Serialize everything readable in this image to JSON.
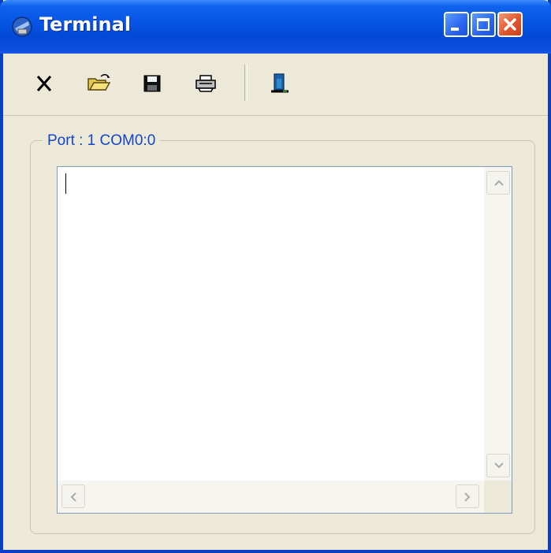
{
  "window": {
    "title": "Terminal",
    "icon": "terminal-app-icon"
  },
  "titlebar_buttons": {
    "minimize": "minimize-icon",
    "maximize": "maximize-icon",
    "close": "close-icon"
  },
  "toolbar": {
    "items": [
      "clear-icon",
      "open-folder-icon",
      "save-floppy-icon",
      "printer-icon",
      "exit-door-icon"
    ]
  },
  "group": {
    "label": "Port : 1 COM0:0"
  },
  "terminal": {
    "content": ""
  }
}
